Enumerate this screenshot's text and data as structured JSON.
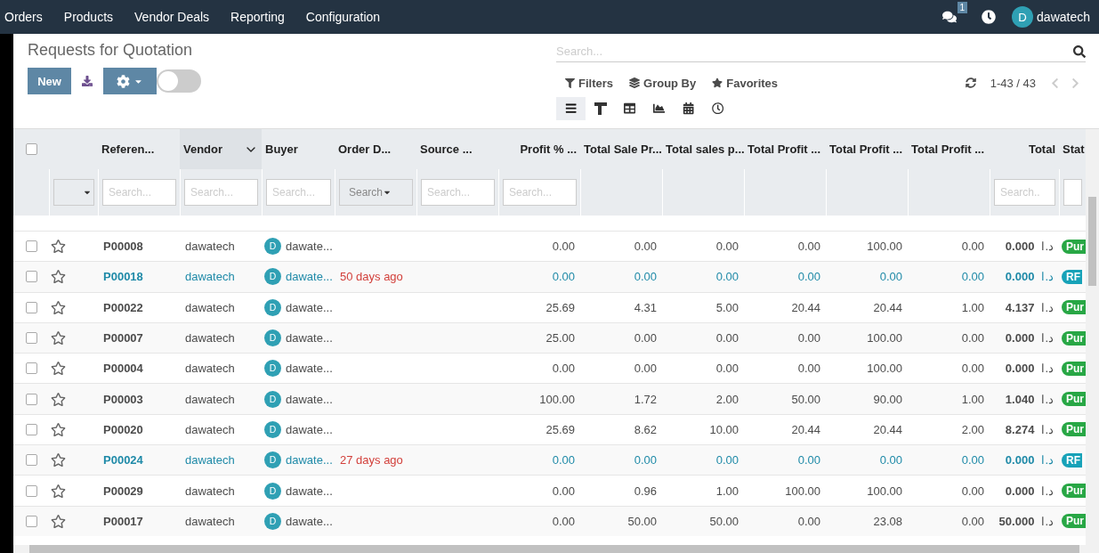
{
  "nav": {
    "menu": [
      "Orders",
      "Products",
      "Vendor Deals",
      "Reporting",
      "Configuration"
    ],
    "messages_badge": "1",
    "user": {
      "initial": "D",
      "name": "dawatech"
    }
  },
  "control_panel": {
    "title": "Requests for Quotation",
    "new_button": "New",
    "toggle": {
      "on": false
    },
    "search": {
      "placeholder": "Search..."
    },
    "search_options": [
      {
        "kind": "filter",
        "label": "Filters"
      },
      {
        "kind": "group",
        "label": "Group By"
      },
      {
        "kind": "favorite",
        "label": "Favorites"
      }
    ],
    "pager": "1-43 / 43",
    "views": [
      {
        "kind": "list",
        "selected": true
      },
      {
        "kind": "kanban",
        "selected": false
      },
      {
        "kind": "pivot",
        "selected": false
      },
      {
        "kind": "graph",
        "selected": false
      },
      {
        "kind": "calendar",
        "selected": false
      },
      {
        "kind": "activity",
        "selected": false
      }
    ]
  },
  "table": {
    "select_all": {
      "checked": false
    },
    "columns": [
      {
        "label": "Referen..."
      },
      {
        "label": "Vendor",
        "sorted": true
      },
      {
        "label": "Buyer"
      },
      {
        "label": "Order D..."
      },
      {
        "label": "Source ..."
      },
      {
        "label": "Profit % ..."
      },
      {
        "label": "Total Sale Pr..."
      },
      {
        "label": "Total sales p..."
      },
      {
        "label": "Total Profit ..."
      },
      {
        "label": "Total Profit ..."
      },
      {
        "label": "Total Profit ..."
      },
      {
        "label": "Total"
      },
      {
        "label": "Stat"
      }
    ],
    "filters": [
      {
        "kind": "select"
      },
      {
        "kind": "input",
        "placeholder": "Search..."
      },
      {
        "kind": "input",
        "placeholder": "Search..."
      },
      {
        "kind": "input",
        "placeholder": "Search..."
      },
      {
        "kind": "dropdown",
        "placeholder": "Search"
      },
      {
        "kind": "input",
        "placeholder": "Search..."
      },
      {
        "kind": "input",
        "placeholder": "Search..."
      },
      {
        "kind": "none"
      },
      {
        "kind": "none"
      },
      {
        "kind": "none"
      },
      {
        "kind": "none"
      },
      {
        "kind": "none"
      },
      {
        "kind": "input",
        "placeholder": "Search.."
      },
      {
        "kind": "input"
      }
    ],
    "rows": [
      {
        "checked": false,
        "starred": false,
        "highlight": false,
        "reference": "P00008",
        "vendor": "dawatech",
        "buyer": {
          "initial": "D",
          "name": "dawate..."
        },
        "values": [
          "0.00",
          "0.00",
          "0.00",
          "0.00",
          "100.00",
          "0.00"
        ],
        "total": "0.000",
        "currency": "د.ا",
        "status": {
          "label": "Pur",
          "color": "#28a745"
        }
      },
      {
        "checked": false,
        "starred": false,
        "highlight": true,
        "reference": "P00018",
        "vendor": "dawatech",
        "buyer": {
          "initial": "D",
          "name": "dawate..."
        },
        "order_date": "50 days ago",
        "values": [
          "0.00",
          "0.00",
          "0.00",
          "0.00",
          "0.00",
          "0.00"
        ],
        "total": "0.000",
        "currency": "د.ا",
        "status": {
          "label": "RF",
          "color": "#17a2b8"
        }
      },
      {
        "checked": false,
        "starred": false,
        "highlight": false,
        "reference": "P00022",
        "vendor": "dawatech",
        "buyer": {
          "initial": "D",
          "name": "dawate..."
        },
        "values": [
          "25.69",
          "4.31",
          "5.00",
          "20.44",
          "20.44",
          "1.00"
        ],
        "total": "4.137",
        "currency": "د.ا",
        "status": {
          "label": "Pur",
          "color": "#28a745"
        }
      },
      {
        "checked": false,
        "starred": false,
        "highlight": false,
        "reference": "P00007",
        "vendor": "dawatech",
        "buyer": {
          "initial": "D",
          "name": "dawate..."
        },
        "values": [
          "25.00",
          "0.00",
          "0.00",
          "0.00",
          "100.00",
          "0.00"
        ],
        "total": "0.000",
        "currency": "د.ا",
        "status": {
          "label": "Pur",
          "color": "#28a745"
        }
      },
      {
        "checked": false,
        "starred": false,
        "highlight": false,
        "reference": "P00004",
        "vendor": "dawatech",
        "buyer": {
          "initial": "D",
          "name": "dawate..."
        },
        "values": [
          "0.00",
          "0.00",
          "0.00",
          "0.00",
          "100.00",
          "0.00"
        ],
        "total": "0.000",
        "currency": "د.ا",
        "status": {
          "label": "Pur",
          "color": "#28a745"
        }
      },
      {
        "checked": false,
        "starred": false,
        "highlight": false,
        "reference": "P00003",
        "vendor": "dawatech",
        "buyer": {
          "initial": "D",
          "name": "dawate..."
        },
        "values": [
          "100.00",
          "1.72",
          "2.00",
          "50.00",
          "90.00",
          "1.00"
        ],
        "total": "1.040",
        "currency": "د.ا",
        "status": {
          "label": "Pur",
          "color": "#28a745"
        }
      },
      {
        "checked": false,
        "starred": false,
        "highlight": false,
        "reference": "P00020",
        "vendor": "dawatech",
        "buyer": {
          "initial": "D",
          "name": "dawate..."
        },
        "values": [
          "25.69",
          "8.62",
          "10.00",
          "20.44",
          "20.44",
          "2.00"
        ],
        "total": "8.274",
        "currency": "د.ا",
        "status": {
          "label": "Pur",
          "color": "#28a745"
        }
      },
      {
        "checked": false,
        "starred": false,
        "highlight": true,
        "reference": "P00024",
        "vendor": "dawatech",
        "buyer": {
          "initial": "D",
          "name": "dawate..."
        },
        "order_date": "27 days ago",
        "values": [
          "0.00",
          "0.00",
          "0.00",
          "0.00",
          "0.00",
          "0.00"
        ],
        "total": "0.000",
        "currency": "د.ا",
        "status": {
          "label": "RF",
          "color": "#17a2b8"
        }
      },
      {
        "checked": false,
        "starred": false,
        "highlight": false,
        "reference": "P00029",
        "vendor": "dawatech",
        "buyer": {
          "initial": "D",
          "name": "dawate..."
        },
        "values": [
          "0.00",
          "0.96",
          "1.00",
          "100.00",
          "100.00",
          "0.00"
        ],
        "total": "0.000",
        "currency": "د.ا",
        "status": {
          "label": "Pur",
          "color": "#28a745"
        }
      },
      {
        "checked": false,
        "starred": false,
        "highlight": false,
        "reference": "P00017",
        "vendor": "dawatech",
        "buyer": {
          "initial": "D",
          "name": "dawate..."
        },
        "values": [
          "0.00",
          "50.00",
          "50.00",
          "0.00",
          "23.08",
          "0.00"
        ],
        "total": "50.000",
        "currency": "د.ا",
        "status": {
          "label": "Pur",
          "color": "#28a745"
        }
      }
    ]
  }
}
